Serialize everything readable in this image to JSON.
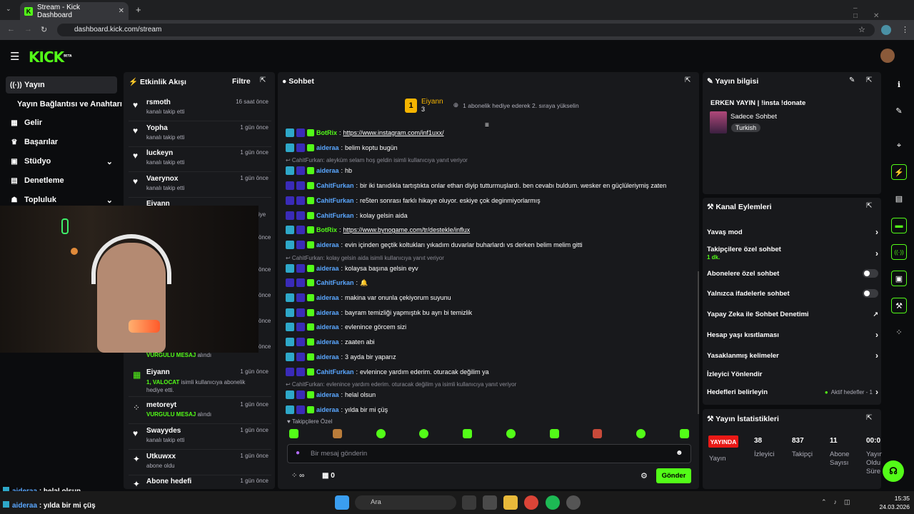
{
  "browser": {
    "tab_title": "Stream - Kick Dashboard",
    "url": "dashboard.kick.com/stream"
  },
  "app": {
    "logo": "KICK",
    "logo_badge": "BETA"
  },
  "sidebar": {
    "items": [
      {
        "label": "Yayın",
        "icon": "broadcast-icon",
        "active": true
      },
      {
        "label": "Yayın Bağlantısı ve Anahtarı",
        "icon": "",
        "active": false
      },
      {
        "label": "Gelir",
        "icon": "revenue-icon"
      },
      {
        "label": "Başarılar",
        "icon": "trophy-icon"
      },
      {
        "label": "Stüdyo",
        "icon": "studio-icon",
        "expandable": true
      },
      {
        "label": "Denetleme",
        "icon": "moderation-icon"
      },
      {
        "label": "Topluluk",
        "icon": "community-icon",
        "expandable": true
      }
    ]
  },
  "activity": {
    "title": "Etkinlik Akışı",
    "filter": "Filtre",
    "items_top": [
      {
        "name": "rsmoth",
        "sub": "kanalı takip etti",
        "time": "16 saat önce",
        "icon": "heart"
      },
      {
        "name": "Yopha",
        "sub": "kanalı takip etti",
        "time": "1 gün önce",
        "icon": "heart"
      },
      {
        "name": "luckeyn",
        "sub": "kanalı takip etti",
        "time": "1 gün önce",
        "icon": "heart"
      },
      {
        "name": "Vaerynox",
        "sub": "kanalı takip etti",
        "time": "1 gün önce",
        "icon": "heart"
      },
      {
        "name": "Eiyann",
        "sub": "",
        "time": "",
        "icon": "gift"
      }
    ],
    "partial_right": [
      "iye",
      "önce",
      "önce",
      "önce",
      "önce",
      "önce",
      "önce",
      "önce",
      "önce"
    ],
    "partial_bottom": {
      "highlight": "VURGULU MESAJ",
      "rest": "alındı"
    },
    "items_bottom": [
      {
        "name": "Eiyann",
        "highlight": "1, VALOCAT",
        "sub": "isimli kullanıcıya abonelik hediye etti.",
        "time": "1 gün önce",
        "icon": "gift"
      },
      {
        "name": "metoreyt",
        "highlight": "VURGULU MESAJ",
        "sub": "alındı",
        "time": "1 gün önce",
        "icon": "dots"
      },
      {
        "name": "Swayydes",
        "highlight": "",
        "sub": "kanalı takip etti",
        "time": "1 gün önce",
        "icon": "heart"
      },
      {
        "name": "Utkuwxx",
        "highlight": "",
        "sub": "abone oldu",
        "time": "1 gün önce",
        "icon": "star"
      },
      {
        "name": "Abone hedefi",
        "highlight": "",
        "sub": "",
        "time": "1 gün önce",
        "icon": "star"
      }
    ]
  },
  "chat": {
    "title": "Sohbet",
    "pinned": {
      "rank": "1",
      "name": "Eiyann",
      "count": "3",
      "text": "1 abonelik hediye ederek 2. sıraya yükselin"
    },
    "messages": [
      {
        "type": "msg",
        "user": "BotRix",
        "bot": true,
        "text": "https://www.instagram.com/inf1uxx/",
        "link": true
      },
      {
        "type": "msg",
        "user": "aideraa",
        "text": "belim koptu bugün"
      },
      {
        "type": "reply",
        "text": "CahitFurkan: aleyküm selam hoş geldin isimli kullanıcıya yanıt veriyor"
      },
      {
        "type": "msg",
        "user": "aideraa",
        "text": "hb"
      },
      {
        "type": "msg",
        "user": "CahitFurkan",
        "text": "bir iki tanıdıkla tartıştıkta onlar ethan diyip tutturmuşlardı. ben cevabı buldum. wesker en güçlüleriymiş zaten"
      },
      {
        "type": "msg",
        "user": "CahitFurkan",
        "text": "re5ten sonrası farklı hikaye oluyor. eskiye çok deginmiyorlarmış"
      },
      {
        "type": "msg",
        "user": "CahitFurkan",
        "text": "kolay gelsin aida"
      },
      {
        "type": "msg",
        "user": "BotRix",
        "bot": true,
        "text": "https://www.bynogame.com/tr/destekle/influx",
        "link": true
      },
      {
        "type": "msg",
        "user": "aideraa",
        "text": "evin içinden geçtik koltukları yıkadım duvarlar buharlardı vs derken belim melim gitti"
      },
      {
        "type": "reply",
        "text": "CahitFurkan: kolay gelsin aida isimli kullanıcıya yanıt veriyor"
      },
      {
        "type": "msg",
        "user": "aideraa",
        "text": "kolaysa başına gelsin eyv"
      },
      {
        "type": "msg",
        "user": "CahitFurkan",
        "text": "🔔"
      },
      {
        "type": "msg",
        "user": "aideraa",
        "text": "makina var onunla çekiyorum suyunu"
      },
      {
        "type": "msg",
        "user": "aideraa",
        "text": "bayram temizliği yapmıştık bu ayrı bi temizlik"
      },
      {
        "type": "msg",
        "user": "aideraa",
        "text": "evlenince görcem sizi"
      },
      {
        "type": "msg",
        "user": "aideraa",
        "text": "zaaten abi"
      },
      {
        "type": "msg",
        "user": "aideraa",
        "text": "3 ayda bir yaparız"
      },
      {
        "type": "msg",
        "user": "CahitFurkan",
        "text": "evlenince yardım ederim. oturacak değilim ya"
      },
      {
        "type": "reply",
        "text": "CahitFurkan: evlenince yardım ederim. oturacak değilim ya isimli kullanıcıya yanıt veriyor"
      },
      {
        "type": "msg",
        "user": "aideraa",
        "text": "helal olsun"
      },
      {
        "type": "msg",
        "user": "aideraa",
        "text": "yılda bir mi çüş"
      }
    ],
    "followers_only_label": "Takipçilere Özel",
    "input_placeholder": "Bir mesaj gönderin",
    "points": "0",
    "send_label": "Gönder",
    "infinity": "∞"
  },
  "stream_info": {
    "title": "Yayın bilgisi",
    "stream_title": "ERKEN YAYIN | !insta !donate",
    "category": "Sadece Sohbet",
    "language": "Turkish"
  },
  "channel_actions": {
    "title": "Kanal Eylemleri",
    "items": [
      {
        "label": "Yavaş mod",
        "control": "chevron"
      },
      {
        "label": "Takipçilere özel sohbet",
        "sub": "1 dk.",
        "control": "chevron"
      },
      {
        "label": "Abonelere özel sohbet",
        "control": "toggle"
      },
      {
        "label": "Yalnızca ifadelerle sohbet",
        "control": "toggle"
      },
      {
        "label": "Yapay Zeka ile Sohbet Denetimi",
        "control": "external"
      },
      {
        "label": "Hesap yaşı kısıtlaması",
        "control": "chevron"
      },
      {
        "label": "Yasaklanmış kelimeler",
        "control": "chevron"
      },
      {
        "label": "İzleyici Yönlendir",
        "control": "none"
      },
      {
        "label": "Hedefleri belirleyin",
        "control": "chevron",
        "status": "Aktif hedefler - 1"
      }
    ]
  },
  "stats": {
    "title": "Yayın İstatistikleri",
    "live_badge": "YAYINDA",
    "live_label": "Yayın",
    "cols": [
      {
        "value": "38",
        "label": "İzleyici"
      },
      {
        "value": "837",
        "label": "Takipçi"
      },
      {
        "value": "11",
        "label": "Abone Sayısı"
      },
      {
        "value": "00:0",
        "label": "Yayın Oldu Süre"
      }
    ]
  },
  "overlay_chat": [
    {
      "user": "aideraa",
      "text": ": helal olsun"
    },
    {
      "user": "aideraa",
      "text": ": yılda bir mi çüş"
    }
  ],
  "taskbar": {
    "search": "Ara",
    "time": "15:35",
    "date": "24.03.2026"
  },
  "colors": {
    "brand": "#53fc18",
    "panel": "#18191c",
    "bg": "#0b0c0e",
    "username": "#5aa7ff",
    "live": "#e91916"
  }
}
